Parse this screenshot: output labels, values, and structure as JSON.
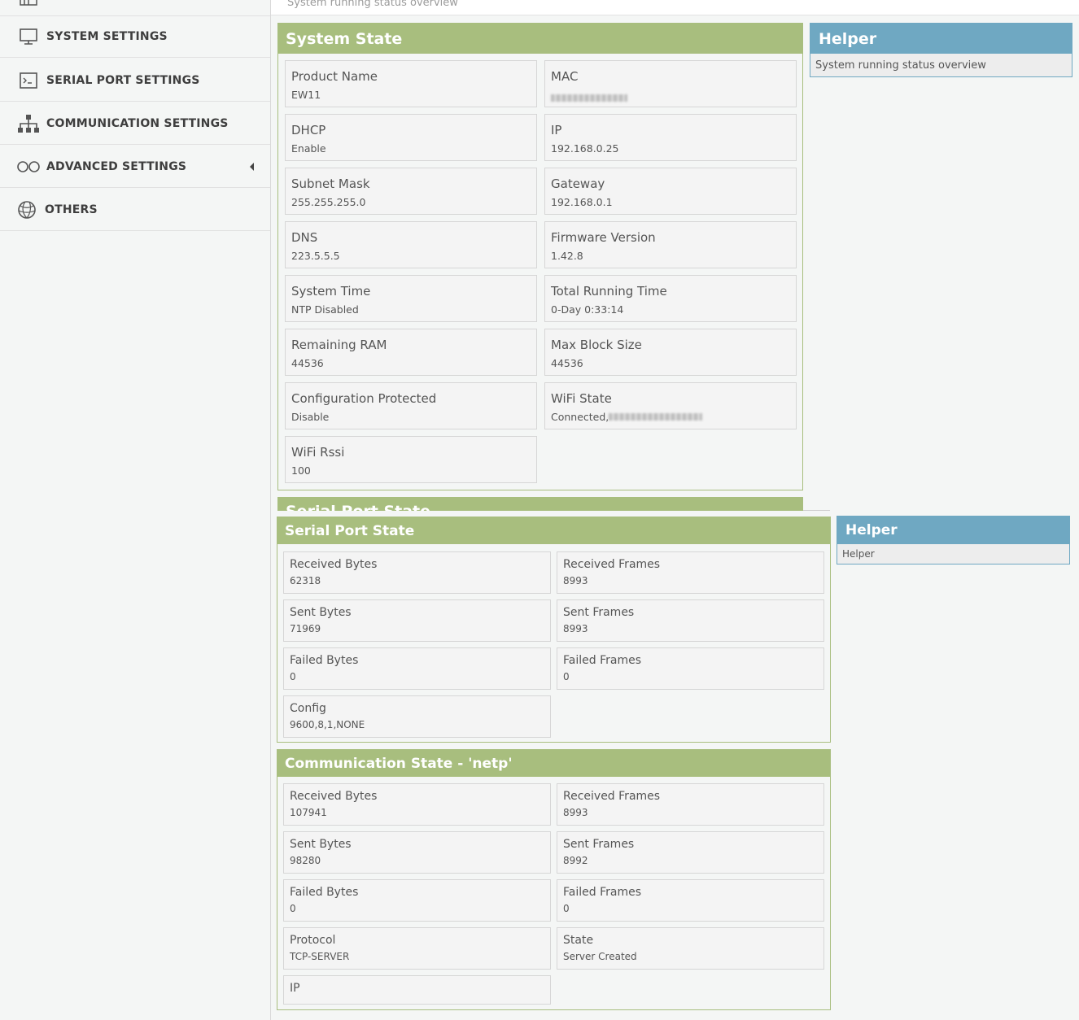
{
  "sidebar": {
    "items": [
      {
        "label": "SYSTEM SETTINGS",
        "icon": "monitor-icon"
      },
      {
        "label": "SERIAL PORT SETTINGS",
        "icon": "terminal-icon"
      },
      {
        "label": "COMMUNICATION SETTINGS",
        "icon": "network-icon"
      },
      {
        "label": "ADVANCED SETTINGS",
        "icon": "infinity-icon"
      },
      {
        "label": "OTHERS",
        "icon": "globe-icon"
      }
    ]
  },
  "page": {
    "subtitle": "System running status overview"
  },
  "system_state": {
    "title": "System State",
    "fields": [
      {
        "label": "Product Name",
        "value": "EW11"
      },
      {
        "label": "MAC",
        "value": ""
      },
      {
        "label": "DHCP",
        "value": "Enable"
      },
      {
        "label": "IP",
        "value": "192.168.0.25"
      },
      {
        "label": "Subnet Mask",
        "value": "255.255.255.0"
      },
      {
        "label": "Gateway",
        "value": "192.168.0.1"
      },
      {
        "label": "DNS",
        "value": "223.5.5.5"
      },
      {
        "label": "Firmware Version",
        "value": "1.42.8"
      },
      {
        "label": "System Time",
        "value": "NTP Disabled"
      },
      {
        "label": "Total Running Time",
        "value": "0-Day 0:33:14"
      },
      {
        "label": "Remaining RAM",
        "value": "44536"
      },
      {
        "label": "Max Block Size",
        "value": "44536"
      },
      {
        "label": "Configuration Protected",
        "value": "Disable"
      },
      {
        "label": "WiFi State",
        "value": "Connected,"
      },
      {
        "label": "WiFi Rssi",
        "value": "100"
      }
    ]
  },
  "helper1": {
    "title": "Helper",
    "text": "System running status overview"
  },
  "serial_peek": {
    "title": "Serial Port State"
  },
  "serial_state": {
    "title": "Serial Port State",
    "fields": [
      {
        "label": "Received Bytes",
        "value": "62318"
      },
      {
        "label": "Received Frames",
        "value": "8993"
      },
      {
        "label": "Sent Bytes",
        "value": "71969"
      },
      {
        "label": "Sent Frames",
        "value": "8993"
      },
      {
        "label": "Failed Bytes",
        "value": "0"
      },
      {
        "label": "Failed Frames",
        "value": "0"
      },
      {
        "label": "Config",
        "value": "9600,8,1,NONE"
      }
    ]
  },
  "helper2": {
    "title": "Helper",
    "text": "Helper"
  },
  "comm_state": {
    "title": "Communication State - 'netp'",
    "fields": [
      {
        "label": "Received Bytes",
        "value": "107941"
      },
      {
        "label": "Received Frames",
        "value": "8993"
      },
      {
        "label": "Sent Bytes",
        "value": "98280"
      },
      {
        "label": "Sent Frames",
        "value": "8992"
      },
      {
        "label": "Failed Bytes",
        "value": "0"
      },
      {
        "label": "Failed Frames",
        "value": "0"
      },
      {
        "label": "Protocol",
        "value": "TCP-SERVER"
      },
      {
        "label": "State",
        "value": "Server Created"
      },
      {
        "label": "IP",
        "value": ""
      }
    ]
  }
}
